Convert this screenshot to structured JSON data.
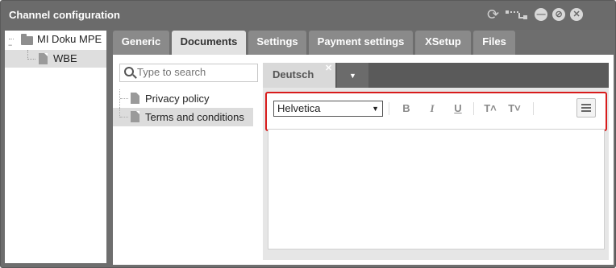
{
  "window": {
    "title": "Channel configuration"
  },
  "tree": {
    "root": {
      "label": "MI Doku MPE"
    },
    "children": [
      {
        "label": "WBE"
      }
    ]
  },
  "tabs": [
    {
      "label": "Generic",
      "active": false
    },
    {
      "label": "Documents",
      "active": true
    },
    {
      "label": "Settings",
      "active": false
    },
    {
      "label": "Payment settings",
      "active": false
    },
    {
      "label": "XSetup",
      "active": false
    },
    {
      "label": "Files",
      "active": false
    }
  ],
  "search": {
    "placeholder": "Type to search",
    "value": ""
  },
  "documents": [
    {
      "label": "Privacy policy",
      "selected": false
    },
    {
      "label": "Terms and conditions",
      "selected": true
    }
  ],
  "editor": {
    "language_tab": "Deutsch",
    "close_glyph": "✕",
    "dropdown_glyph": "▼",
    "font": {
      "value": "Helvetica",
      "arrow": "▼"
    },
    "toolbar": {
      "bold": "B",
      "italic": "I",
      "underline": "U",
      "font_size_up": "T˄",
      "font_size_down": "T˅"
    },
    "content": ""
  },
  "colors": {
    "titlebar": "#6b6b6b",
    "tab_inactive": "#8a8a8a",
    "tab_active": "#e2e2e2",
    "highlight_border": "#d81b1b"
  },
  "icons": {
    "refresh": "refresh-icon",
    "tree_layout": "tree-layout-icon",
    "minimize": "minimize-icon",
    "restore": "restore-icon",
    "close": "close-icon",
    "folder": "folder-icon",
    "document": "document-icon",
    "search": "search-icon",
    "align": "align-icon"
  }
}
